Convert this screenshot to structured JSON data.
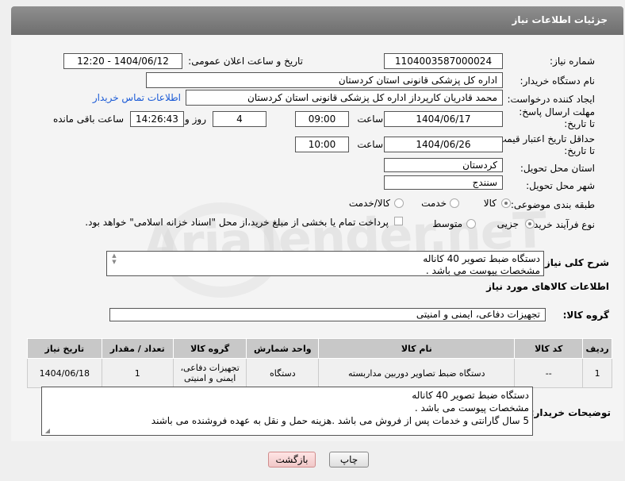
{
  "header": {
    "title": "جزئیات اطلاعات نیاز"
  },
  "fields": {
    "need_number_label": "شماره نیاز:",
    "need_number": "1104003587000024",
    "announce_label": "تاریخ و ساعت اعلان عمومی:",
    "announce_value": "1404/06/12 - 12:20",
    "buyer_label": "نام دستگاه خریدار:",
    "buyer_value": "اداره کل پزشکی قانونی استان کردستان",
    "creator_label": "ایجاد کننده درخواست:",
    "creator_value": "محمد قادریان کارپرداز اداره کل پزشکی قانونی استان کردستان",
    "contact_link": "اطلاعات تماس خریدار",
    "deadline_label": "مهلت ارسال پاسخ: تا تاریخ:",
    "deadline_date": "1404/06/17",
    "time_label": "ساعت",
    "deadline_time": "09:00",
    "days_value": "4",
    "days_label": "روز و",
    "remaining_time": "14:26:43",
    "remaining_label": "ساعت باقی مانده",
    "validity_label": "حداقل تاریخ اعتبار قیمت: تا تاریخ:",
    "validity_date": "1404/06/26",
    "validity_time": "10:00",
    "province_label": "استان محل تحویل:",
    "province_value": "کردستان",
    "city_label": "شهر محل تحویل:",
    "city_value": "سنندج",
    "category_label": "طبقه بندی موضوعی:",
    "cat_goods": "کالا",
    "cat_service": "خدمت",
    "cat_goods_service": "کالا/خدمت",
    "process_label": "نوع فرآیند خرید :",
    "proc_minor": "جزیی",
    "proc_medium": "متوسط",
    "payment_text": "پرداخت تمام یا بخشی از مبلغ خرید،از محل \"اسناد خزانه اسلامی\" خواهد بود."
  },
  "description": {
    "label": "شرح کلی نیاز:",
    "lines": [
      "دستگاه ضبط تصویر 40 کاناله",
      "مشخصات پیوست می باشد ."
    ]
  },
  "goods_section": {
    "title": "اطلاعات کالاهای مورد نیاز",
    "group_label": "گروه کالا:",
    "group_value": "تجهیزات دفاعی، ایمنی و امنیتی"
  },
  "table": {
    "headers": [
      "ردیف",
      "کد کالا",
      "نام کالا",
      "واحد شمارش",
      "گروه کالا",
      "تعداد / مقدار",
      "تاریخ نیاز"
    ],
    "row": {
      "index": "1",
      "code": "--",
      "name": "دستگاه ضبط تصاویر دوربین مداربسته",
      "unit": "دستگاه",
      "group_line1": "تجهیزات دفاعی،",
      "group_line2": "ایمنی و امنیتی",
      "qty": "1",
      "date": "1404/06/18"
    }
  },
  "buyer_notes": {
    "label": "توضیحات خریدار:",
    "lines": [
      "دستگاه ضبط تصویر 40 کاناله",
      "مشخصات پیوست می باشد .",
      "5 سال گارانتی و خدمات پس از فروش می باشد .هزینه حمل و نقل به عهده فروشنده می باشند"
    ]
  },
  "buttons": {
    "print": "چاپ",
    "back": "بازگشت"
  },
  "watermark": "AriaTender.neT"
}
